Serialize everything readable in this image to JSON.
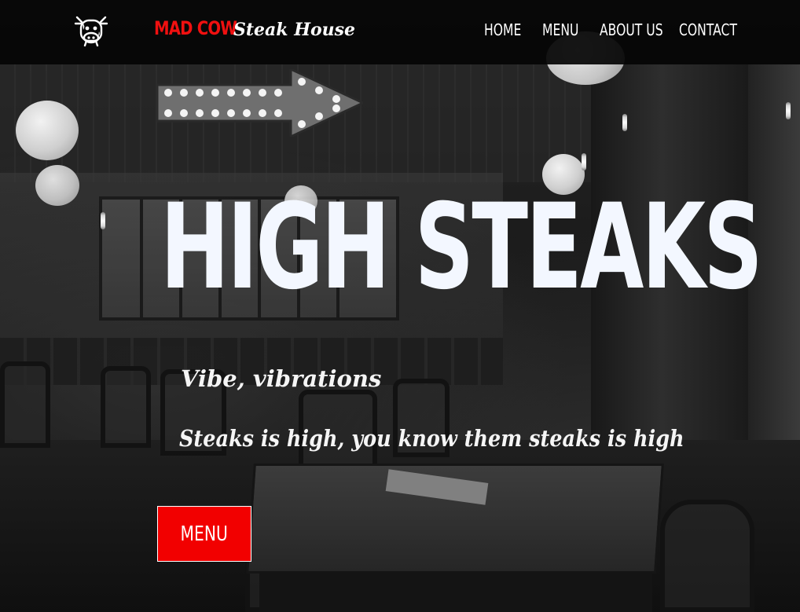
{
  "brand": {
    "name_red": "MAD COW",
    "name_script": "Steak House",
    "logo_icon": "cow-icon",
    "accent_color": "#f20000"
  },
  "nav": {
    "items": [
      {
        "label": "HOME"
      },
      {
        "label": "MENU"
      },
      {
        "label": "ABOUT US"
      },
      {
        "label": "CONTACT"
      }
    ]
  },
  "hero": {
    "headline": "HIGH STEAKS",
    "tagline_1": "Vibe, vibrations",
    "tagline_2": "Steaks is high, you know them steaks is high",
    "cta_label": "MENU",
    "background_image": "black-and-white-restaurant-interior"
  }
}
